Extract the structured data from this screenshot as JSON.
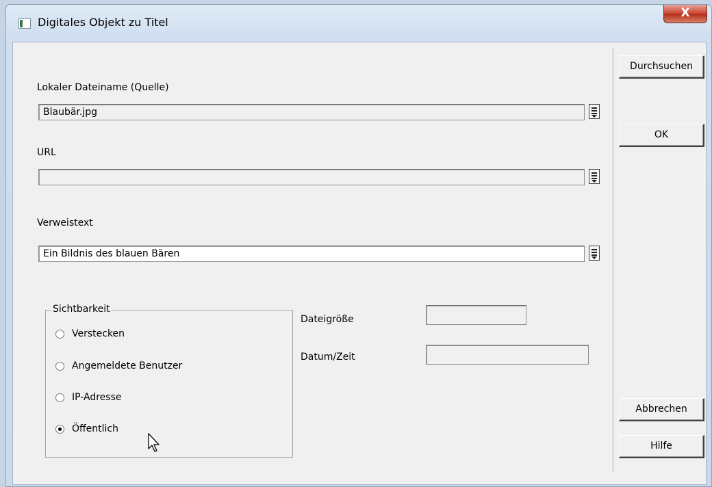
{
  "window": {
    "title": "Digitales Objekt zu Titel",
    "close_glyph": "X"
  },
  "source": {
    "label": "Lokaler Dateiname (Quelle)",
    "value": "Blaubär.jpg"
  },
  "url": {
    "label": "URL",
    "value": ""
  },
  "link_text": {
    "label": "Verweistext",
    "value": "Ein Bildnis des blauen Bären"
  },
  "visibility": {
    "label": "Sichtbarkeit",
    "options": [
      "Verstecken",
      "Angemeldete Benutzer",
      "IP-Adresse",
      "Öffentlich"
    ],
    "selected": "Öffentlich"
  },
  "file_size": {
    "label": "Dateigröße",
    "value": ""
  },
  "datetime": {
    "label": "Datum/Zeit",
    "value": ""
  },
  "buttons": {
    "browse": "Durchsuchen",
    "ok": "OK",
    "cancel": "Abbrechen",
    "help": "Hilfe"
  },
  "icons": {
    "picker": "list-picker-icon",
    "cursor": "mouse-pointer-icon"
  }
}
